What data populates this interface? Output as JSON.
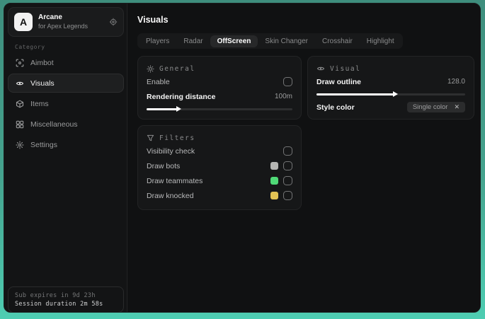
{
  "colors": {
    "accent_teal": "#4ecdb2",
    "window_bg": "#111213",
    "card_bg": "#161718",
    "swatch_bots": "#b5b5b3",
    "swatch_teammates": "#4fd977",
    "swatch_knocked": "#e2c254"
  },
  "sidebar": {
    "brand": {
      "initial": "A",
      "title": "Arcane",
      "subtitle": "for Apex Legends"
    },
    "category_label": "Category",
    "items": [
      {
        "label": "Aimbot",
        "icon": "crosshair"
      },
      {
        "label": "Visuals",
        "icon": "eye-scan",
        "selected": true
      },
      {
        "label": "Items",
        "icon": "package"
      },
      {
        "label": "Miscellaneous",
        "icon": "grid"
      },
      {
        "label": "Settings",
        "icon": "gear"
      }
    ],
    "footer": {
      "line1": "Sub expires in 9d 23h",
      "line2": "Session duration 2m 58s"
    }
  },
  "main": {
    "title": "Visuals",
    "tabs": [
      {
        "label": "Players"
      },
      {
        "label": "Radar"
      },
      {
        "label": "OffScreen",
        "selected": true
      },
      {
        "label": "Skin Changer"
      },
      {
        "label": "Crosshair"
      },
      {
        "label": "Highlight"
      }
    ],
    "cards": {
      "general": {
        "title": "General",
        "rows": [
          {
            "label": "Enable",
            "control": "checkbox",
            "checked": false
          },
          {
            "label": "Rendering distance",
            "value": "100m",
            "control": "slider",
            "fill": "21%"
          }
        ]
      },
      "visual": {
        "title": "Visual",
        "rows": [
          {
            "label": "Draw outline",
            "value": "128.0",
            "control": "slider",
            "fill": "52%"
          },
          {
            "label": "Style color",
            "control": "select-chip",
            "chip": {
              "label": "Single color",
              "close": "✕"
            }
          }
        ]
      },
      "filters": {
        "title": "Filters",
        "rows": [
          {
            "label": "Visibility check",
            "control": "checkbox",
            "checked": false
          },
          {
            "label": "Draw bots",
            "swatch_color": "#b5b5b3",
            "control": "checkbox",
            "checked": false
          },
          {
            "label": "Draw teammates",
            "swatch_color": "#4fd977",
            "control": "checkbox",
            "checked": false
          },
          {
            "label": "Draw knocked",
            "swatch_color": "#e2c254",
            "control": "checkbox",
            "checked": false
          }
        ]
      }
    }
  }
}
